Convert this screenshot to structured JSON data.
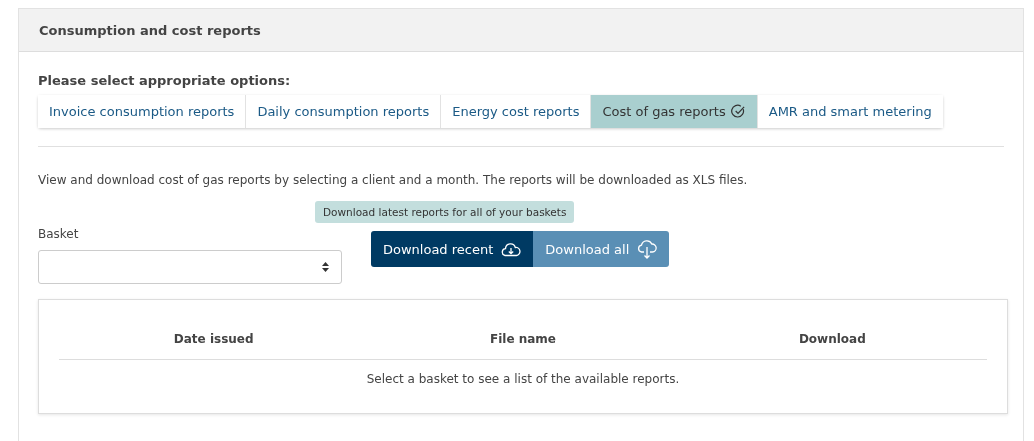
{
  "panel": {
    "title": "Consumption and cost reports"
  },
  "options_label": "Please select appropriate options:",
  "tabs": [
    {
      "label": "Invoice consumption reports",
      "selected": false
    },
    {
      "label": "Daily consumption reports",
      "selected": false
    },
    {
      "label": "Energy cost reports",
      "selected": false
    },
    {
      "label": "Cost of gas reports",
      "selected": true
    },
    {
      "label": "AMR and smart metering",
      "selected": false
    }
  ],
  "description": "View and download cost of gas reports by selecting a client and a month. The reports will be downloaded as XLS files.",
  "basket": {
    "label": "Basket"
  },
  "tooltip": "Download latest reports for all of your baskets",
  "buttons": [
    {
      "label": "Download recent",
      "kind": "primary"
    },
    {
      "label": "Download all",
      "kind": "secondary"
    }
  ],
  "table": {
    "columns": [
      "Date issued",
      "File name",
      "Download"
    ],
    "empty_message": "Select a basket to see a list of the available reports."
  }
}
